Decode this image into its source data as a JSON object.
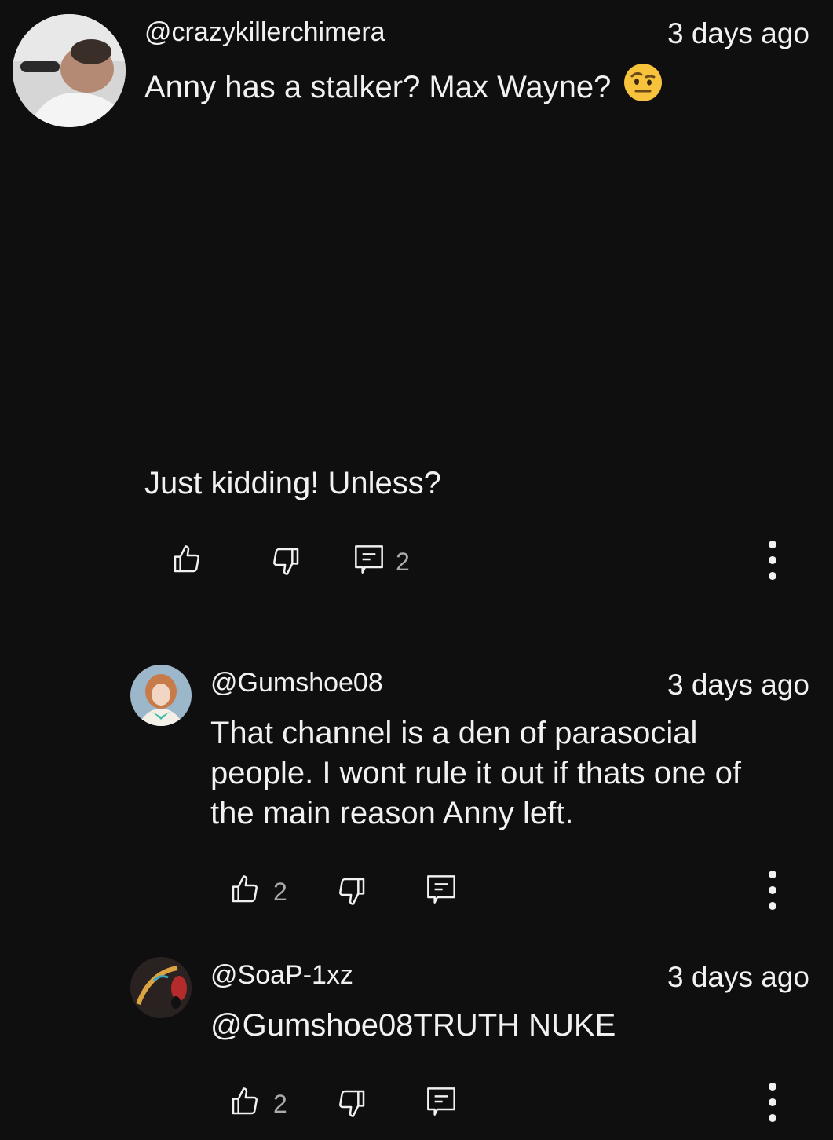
{
  "comment": {
    "handle": "@crazykillerchimera",
    "time": "3 days ago",
    "line1": "Anny has a stalker? Max Wayne?",
    "emoji_name": "face-with-raised-eyebrow-emoji",
    "line2": "Just kidding! Unless?",
    "reply_count": "2"
  },
  "replies": [
    {
      "handle": "@Gumshoe08",
      "time": "3 days ago",
      "text": "That channel is a den of parasocial people. I wont rule it out if thats one of the main reason Anny left.",
      "like_count": "2"
    },
    {
      "handle": "@SoaP-1xz",
      "time": "3 days ago",
      "text": "@Gumshoe08TRUTH NUKE",
      "like_count": "2"
    }
  ],
  "colors": {
    "background": "#0f0f0f",
    "text": "#f1f1f1",
    "secondary": "#aaaaaa"
  },
  "icons": [
    "like-icon",
    "dislike-icon",
    "reply-icon",
    "more-options-icon"
  ]
}
